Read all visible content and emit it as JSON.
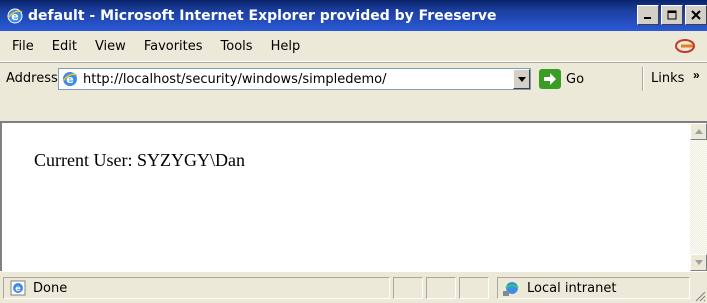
{
  "window": {
    "title": "default - Microsoft Internet Explorer provided by Freeserve",
    "controls": [
      "minimize-icon",
      "maximize-icon",
      "close-icon"
    ]
  },
  "menu": {
    "items": [
      "File",
      "Edit",
      "View",
      "Favorites",
      "Tools",
      "Help"
    ]
  },
  "address_bar": {
    "label": "Address",
    "url": "http://localhost/security/windows/simpledemo/",
    "go_label": "Go",
    "links_label": "Links",
    "links_chevron": "»"
  },
  "page": {
    "text": "Current User: SYZYGY\\Dan"
  },
  "status": {
    "text": "Done",
    "zone": "Local intranet"
  },
  "colors": {
    "title_bar": "#1c3fa0",
    "go_button": "#3a9d23",
    "chrome": "#ece9d8"
  }
}
